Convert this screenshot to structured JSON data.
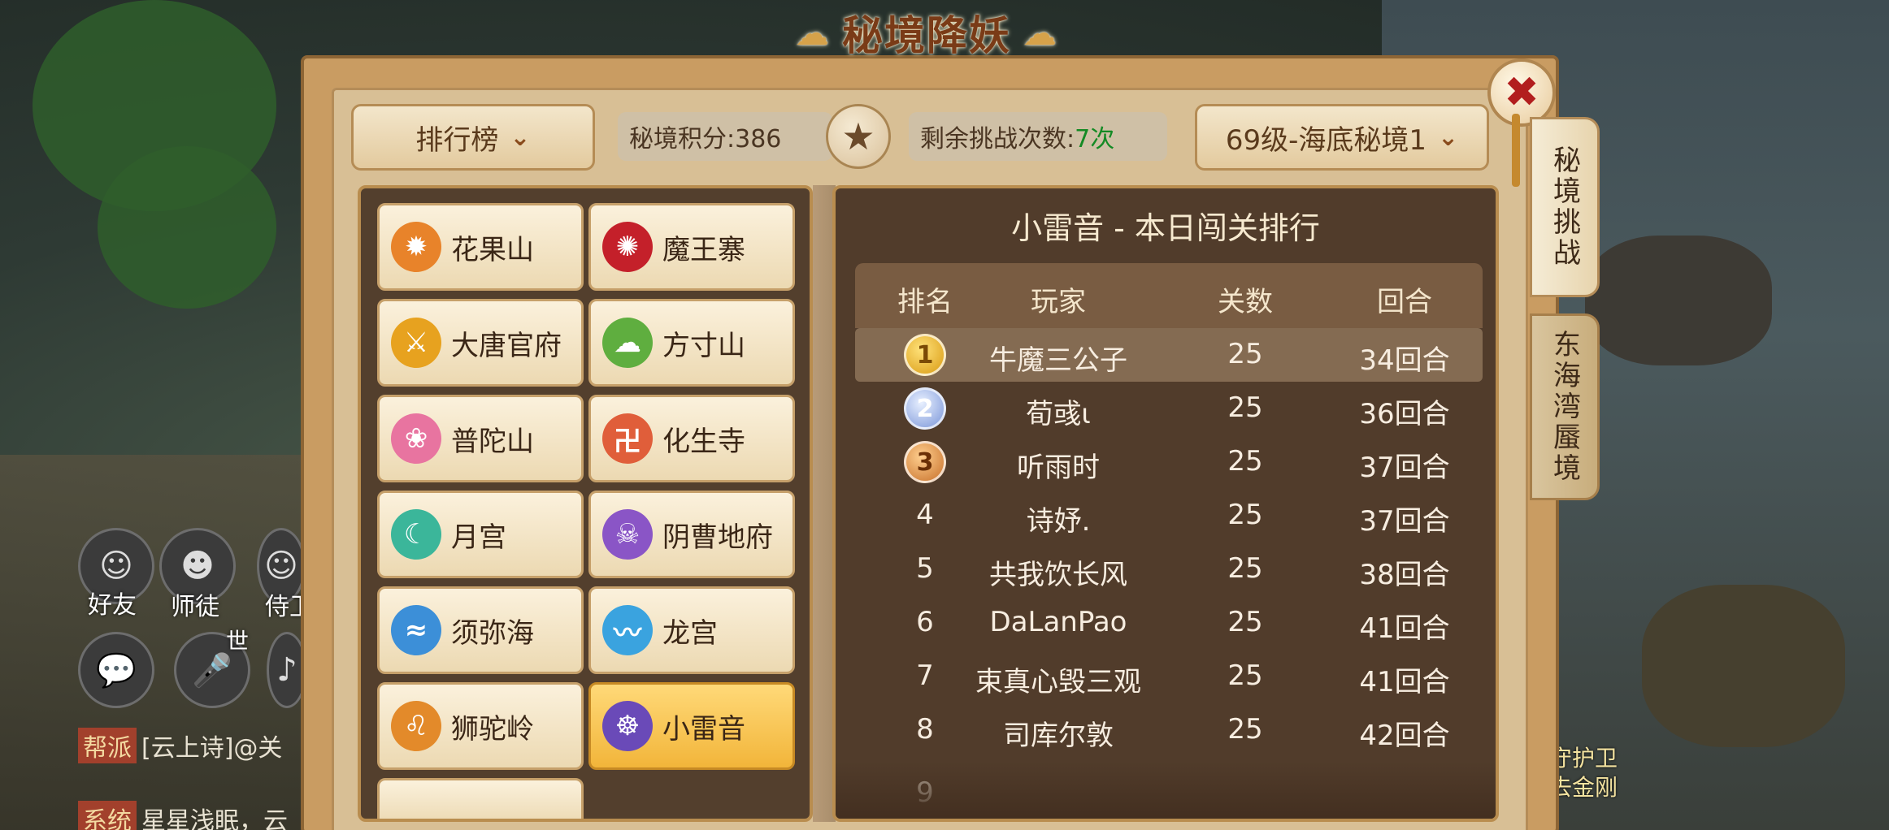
{
  "window": {
    "title": "秘境降妖",
    "close_icon": "✖"
  },
  "topbar": {
    "ranking_dropdown": "排行榜",
    "score_text": "秘境积分:386",
    "remaining_label": "剩余挑战次数:",
    "remaining_value": "7次",
    "level_dropdown": "69级-海底秘境1",
    "chevron": "⌄",
    "star": "★"
  },
  "side_tabs": [
    "秘境挑战",
    "东海湾蜃境"
  ],
  "schools": [
    {
      "label": "花果山",
      "glyph": "✹",
      "color": "#e8832a"
    },
    {
      "label": "魔王寨",
      "glyph": "✺",
      "color": "#c4202a"
    },
    {
      "label": "大唐官府",
      "glyph": "⚔",
      "color": "#e7a21f"
    },
    {
      "label": "方寸山",
      "glyph": "☁",
      "color": "#5fae3f"
    },
    {
      "label": "普陀山",
      "glyph": "❀",
      "color": "#e874a0"
    },
    {
      "label": "化生寺",
      "glyph": "卍",
      "color": "#e05e3a"
    },
    {
      "label": "月宫",
      "glyph": "☾",
      "color": "#3bb69a"
    },
    {
      "label": "阴曹地府",
      "glyph": "☠",
      "color": "#8a55c6"
    },
    {
      "label": "须弥海",
      "glyph": "≈",
      "color": "#3c8fd8"
    },
    {
      "label": "龙宫",
      "glyph": "〰",
      "color": "#3aa3df"
    },
    {
      "label": "狮驼岭",
      "glyph": "♌",
      "color": "#e38a2a"
    },
    {
      "label": "小雷音",
      "glyph": "☸",
      "color": "#6a4ab8"
    }
  ],
  "selected_school": "小雷音",
  "ranking": {
    "title": "小雷音 - 本日闯关排行",
    "columns": [
      "排名",
      "玩家",
      "关数",
      "回合"
    ],
    "rows": [
      {
        "rank": "1",
        "player": "牛魔三公子",
        "stages": "25",
        "rounds": "34回合"
      },
      {
        "rank": "2",
        "player": "荀彧ι",
        "stages": "25",
        "rounds": "36回合"
      },
      {
        "rank": "3",
        "player": "听雨时",
        "stages": "25",
        "rounds": "37回合"
      },
      {
        "rank": "4",
        "player": "诗妤.",
        "stages": "25",
        "rounds": "37回合"
      },
      {
        "rank": "5",
        "player": "共我饮长风",
        "stages": "25",
        "rounds": "38回合"
      },
      {
        "rank": "6",
        "player": "DaLanPao",
        "stages": "25",
        "rounds": "41回合"
      },
      {
        "rank": "7",
        "player": "束真心毁三观",
        "stages": "25",
        "rounds": "41回合"
      },
      {
        "rank": "8",
        "player": "司库尔敦",
        "stages": "25",
        "rounds": "42回合"
      }
    ]
  },
  "hud": {
    "friends": "好友",
    "master": "师徒",
    "partner": "侍卫",
    "world": "世",
    "chat_icon": "💬",
    "mic_icon": "🎤",
    "chat1_tag": "帮派",
    "chat1_text": "[云上诗]@关",
    "chat2_tag": "系统",
    "chat2_text": "星星浅眠，云",
    "guard_label": "守护卫",
    "guard_name": "去金刚"
  }
}
